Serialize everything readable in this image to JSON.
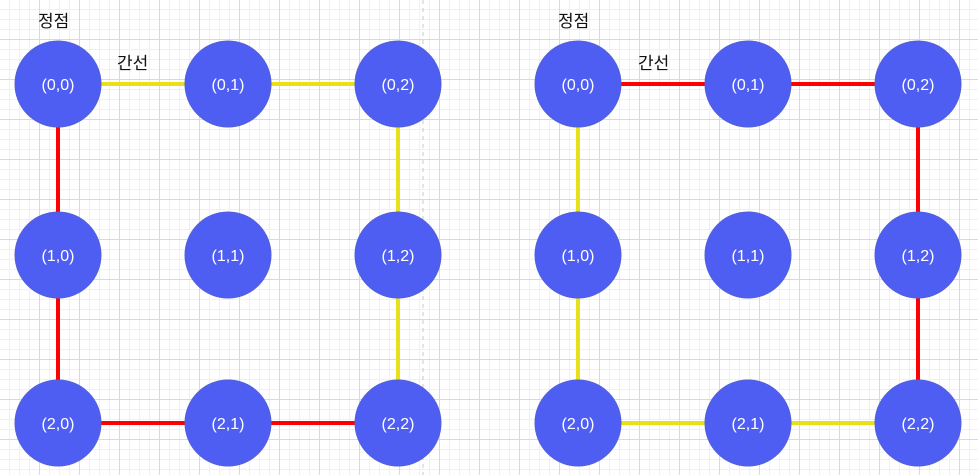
{
  "colors": {
    "node_fill": "#4f5ef2",
    "node_stroke": "#5360d8",
    "red": "#ff0000",
    "yellow": "#e8e01a",
    "divider": "#c8c8c8"
  },
  "panels": [
    {
      "vertex_label": "정점",
      "edge_label": "간선",
      "nodes": [
        {
          "id": "0,0",
          "row": 0,
          "col": 0,
          "label": "(0,0)"
        },
        {
          "id": "0,1",
          "row": 0,
          "col": 1,
          "label": "(0,1)"
        },
        {
          "id": "0,2",
          "row": 0,
          "col": 2,
          "label": "(0,2)"
        },
        {
          "id": "1,0",
          "row": 1,
          "col": 0,
          "label": "(1,0)"
        },
        {
          "id": "1,1",
          "row": 1,
          "col": 1,
          "label": "(1,1)"
        },
        {
          "id": "1,2",
          "row": 1,
          "col": 2,
          "label": "(1,2)"
        },
        {
          "id": "2,0",
          "row": 2,
          "col": 0,
          "label": "(2,0)"
        },
        {
          "id": "2,1",
          "row": 2,
          "col": 1,
          "label": "(2,1)"
        },
        {
          "id": "2,2",
          "row": 2,
          "col": 2,
          "label": "(2,2)"
        }
      ],
      "edges": [
        {
          "from": "0,0",
          "to": "0,1",
          "color": "yellow"
        },
        {
          "from": "0,1",
          "to": "0,2",
          "color": "yellow"
        },
        {
          "from": "0,2",
          "to": "1,2",
          "color": "yellow"
        },
        {
          "from": "1,2",
          "to": "2,2",
          "color": "yellow"
        },
        {
          "from": "0,0",
          "to": "1,0",
          "color": "red"
        },
        {
          "from": "1,0",
          "to": "2,0",
          "color": "red"
        },
        {
          "from": "2,0",
          "to": "2,1",
          "color": "red"
        },
        {
          "from": "2,1",
          "to": "2,2",
          "color": "red"
        }
      ]
    },
    {
      "vertex_label": "정점",
      "edge_label": "간선",
      "nodes": [
        {
          "id": "0,0",
          "row": 0,
          "col": 0,
          "label": "(0,0)"
        },
        {
          "id": "0,1",
          "row": 0,
          "col": 1,
          "label": "(0,1)"
        },
        {
          "id": "0,2",
          "row": 0,
          "col": 2,
          "label": "(0,2)"
        },
        {
          "id": "1,0",
          "row": 1,
          "col": 0,
          "label": "(1,0)"
        },
        {
          "id": "1,1",
          "row": 1,
          "col": 1,
          "label": "(1,1)"
        },
        {
          "id": "1,2",
          "row": 1,
          "col": 2,
          "label": "(1,2)"
        },
        {
          "id": "2,0",
          "row": 2,
          "col": 0,
          "label": "(2,0)"
        },
        {
          "id": "2,1",
          "row": 2,
          "col": 1,
          "label": "(2,1)"
        },
        {
          "id": "2,2",
          "row": 2,
          "col": 2,
          "label": "(2,2)"
        }
      ],
      "edges": [
        {
          "from": "0,0",
          "to": "0,1",
          "color": "red"
        },
        {
          "from": "0,1",
          "to": "0,2",
          "color": "red"
        },
        {
          "from": "0,2",
          "to": "1,2",
          "color": "red"
        },
        {
          "from": "1,2",
          "to": "2,2",
          "color": "red"
        },
        {
          "from": "0,0",
          "to": "1,0",
          "color": "yellow"
        },
        {
          "from": "1,0",
          "to": "2,0",
          "color": "yellow"
        },
        {
          "from": "2,0",
          "to": "2,1",
          "color": "yellow"
        },
        {
          "from": "2,1",
          "to": "2,2",
          "color": "yellow"
        }
      ]
    }
  ]
}
